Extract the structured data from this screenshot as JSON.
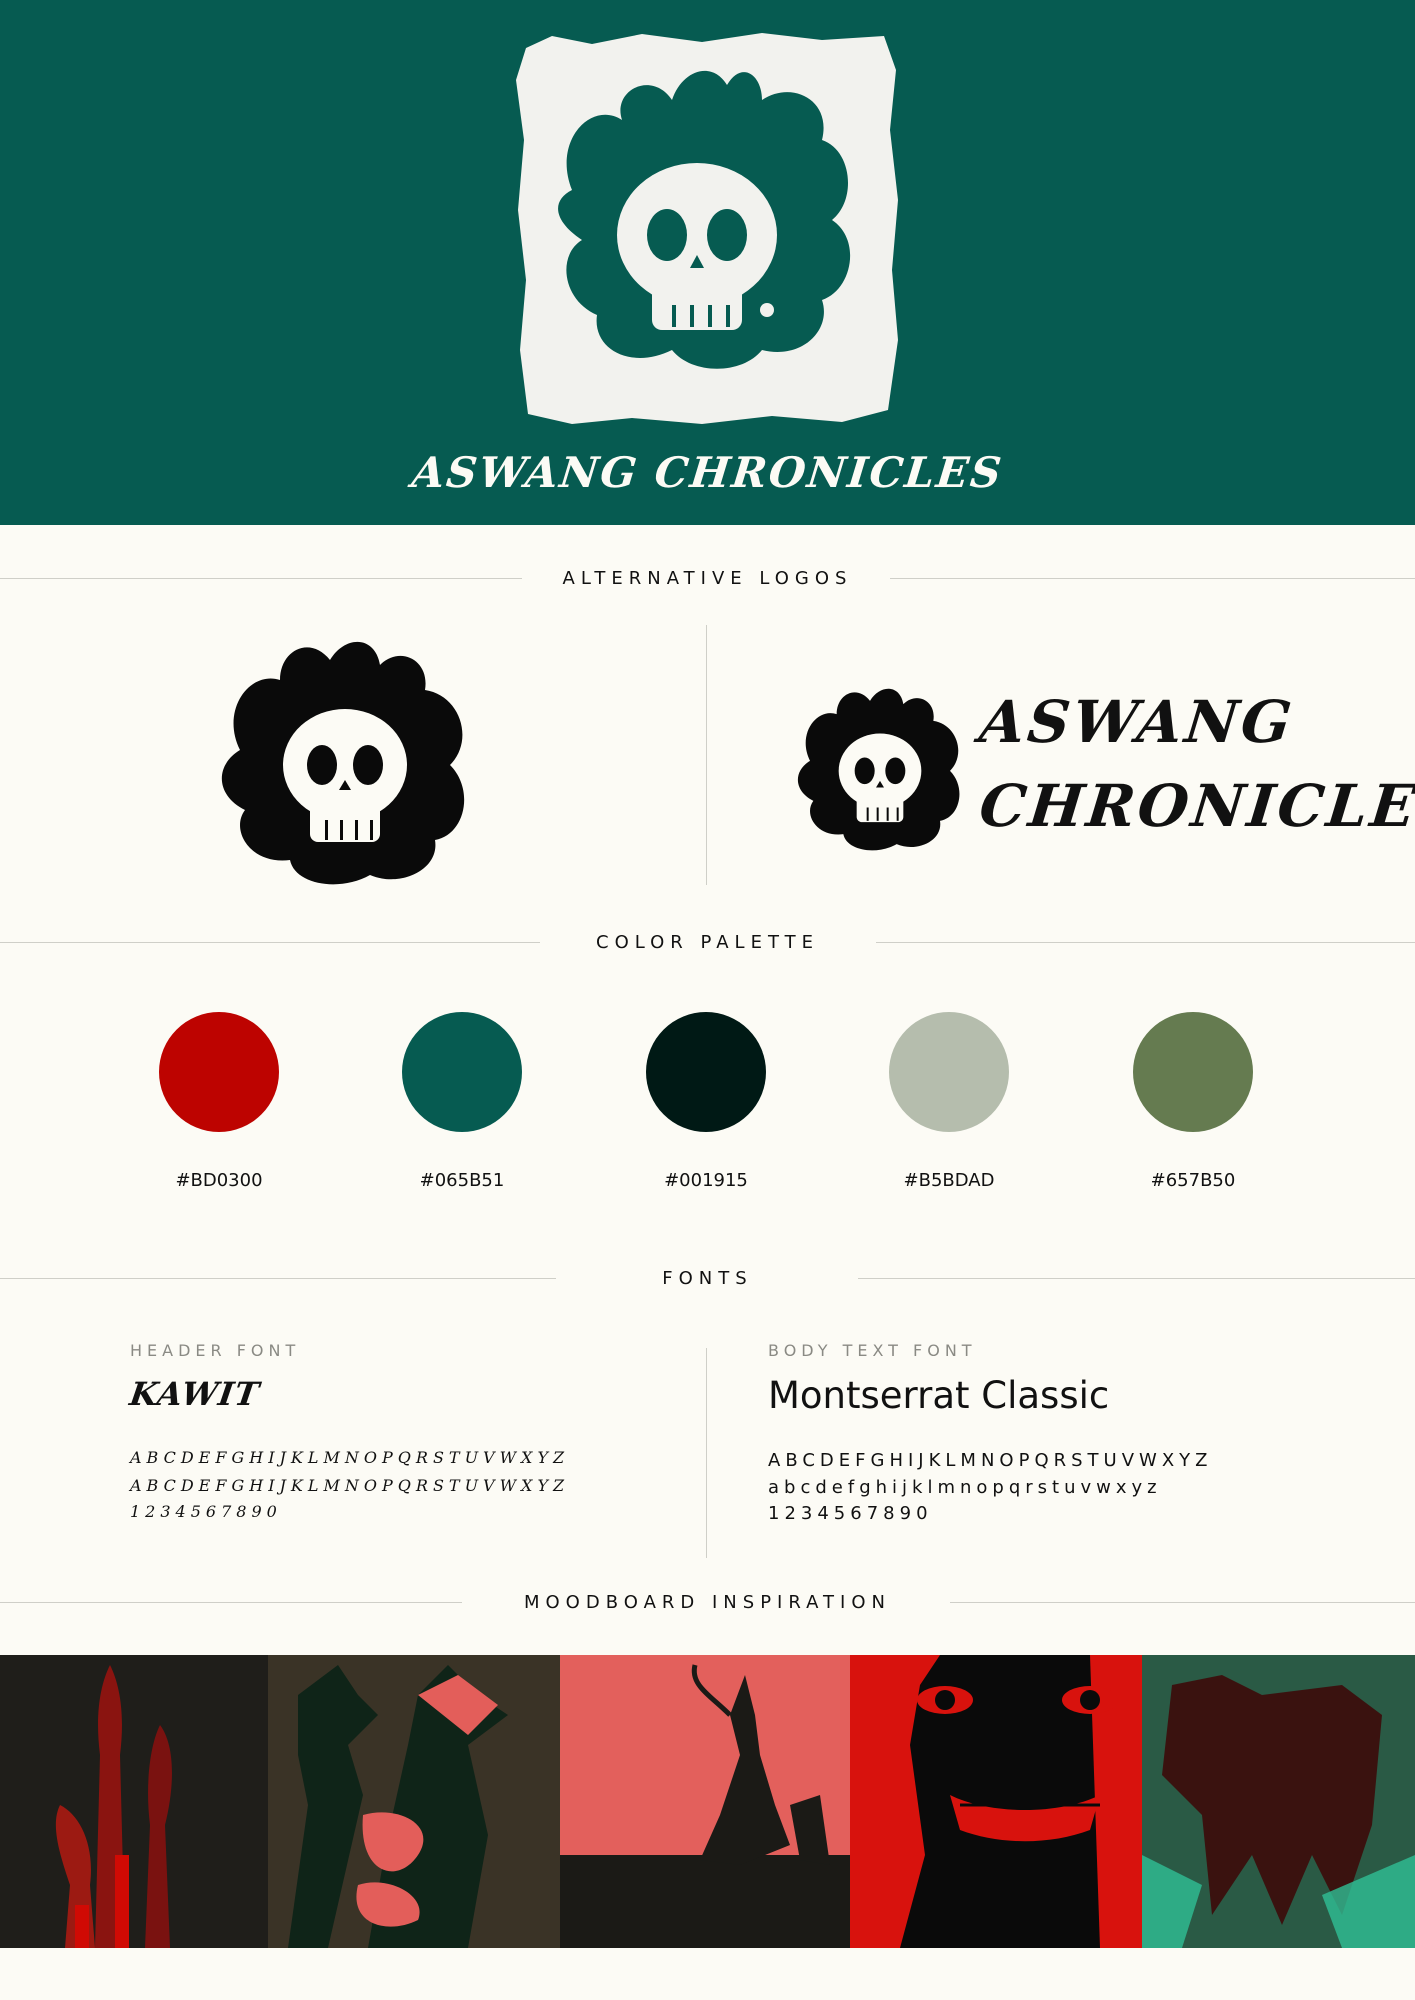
{
  "brand": {
    "title": "ASWANG CHRONICLES",
    "wordmark_line1": "ASWANG",
    "wordmark_line2": "CHRONICLES"
  },
  "sections": {
    "alt_logos": "ALTERNATIVE LOGOS",
    "palette": "COLOR PALETTE",
    "fonts": "FONTS",
    "moodboard": "MOODBOARD INSPIRATION"
  },
  "palette": [
    {
      "hex": "#BD0300",
      "color": "#bd0300"
    },
    {
      "hex": "#065B51",
      "color": "#065b51"
    },
    {
      "hex": "#001915",
      "color": "#001915"
    },
    {
      "hex": "#B5BDAD",
      "color": "#b5bdad"
    },
    {
      "hex": "#657B50",
      "color": "#657b50"
    }
  ],
  "fonts": {
    "header": {
      "label": "HEADER FONT",
      "name": "KAWIT",
      "upper": "ABCDEFGHIJKLMNOPQRSTUVWXYZ",
      "lower": "ABCDEFGHIJKLMNOPQRSTUVWXYZ",
      "digits": "1234567890"
    },
    "body": {
      "label": "BODY TEXT FONT",
      "name": "Montserrat Classic",
      "upper": "ABCDEFGHIJKLMNOPQRSTUVWXYZ",
      "lower": "abcdefghijklmnopqrstuvwxyz",
      "digits": "1234567890"
    }
  },
  "icons": {
    "hero_logo": "skull-flame-icon",
    "alt_mark": "skull-flame-icon",
    "alt_small": "skull-flame-icon"
  },
  "moodboard": [
    {
      "name": "hands-artwork",
      "bg": "#1f1e1a"
    },
    {
      "name": "wolf-creature-artwork",
      "bg": "#3a3326"
    },
    {
      "name": "goat-demon-artwork",
      "bg": "#e3605c"
    },
    {
      "name": "grinning-face-artwork",
      "bg": "#0a0a0a"
    },
    {
      "name": "beast-woodcut-artwork",
      "bg": "#3c1a16"
    }
  ]
}
